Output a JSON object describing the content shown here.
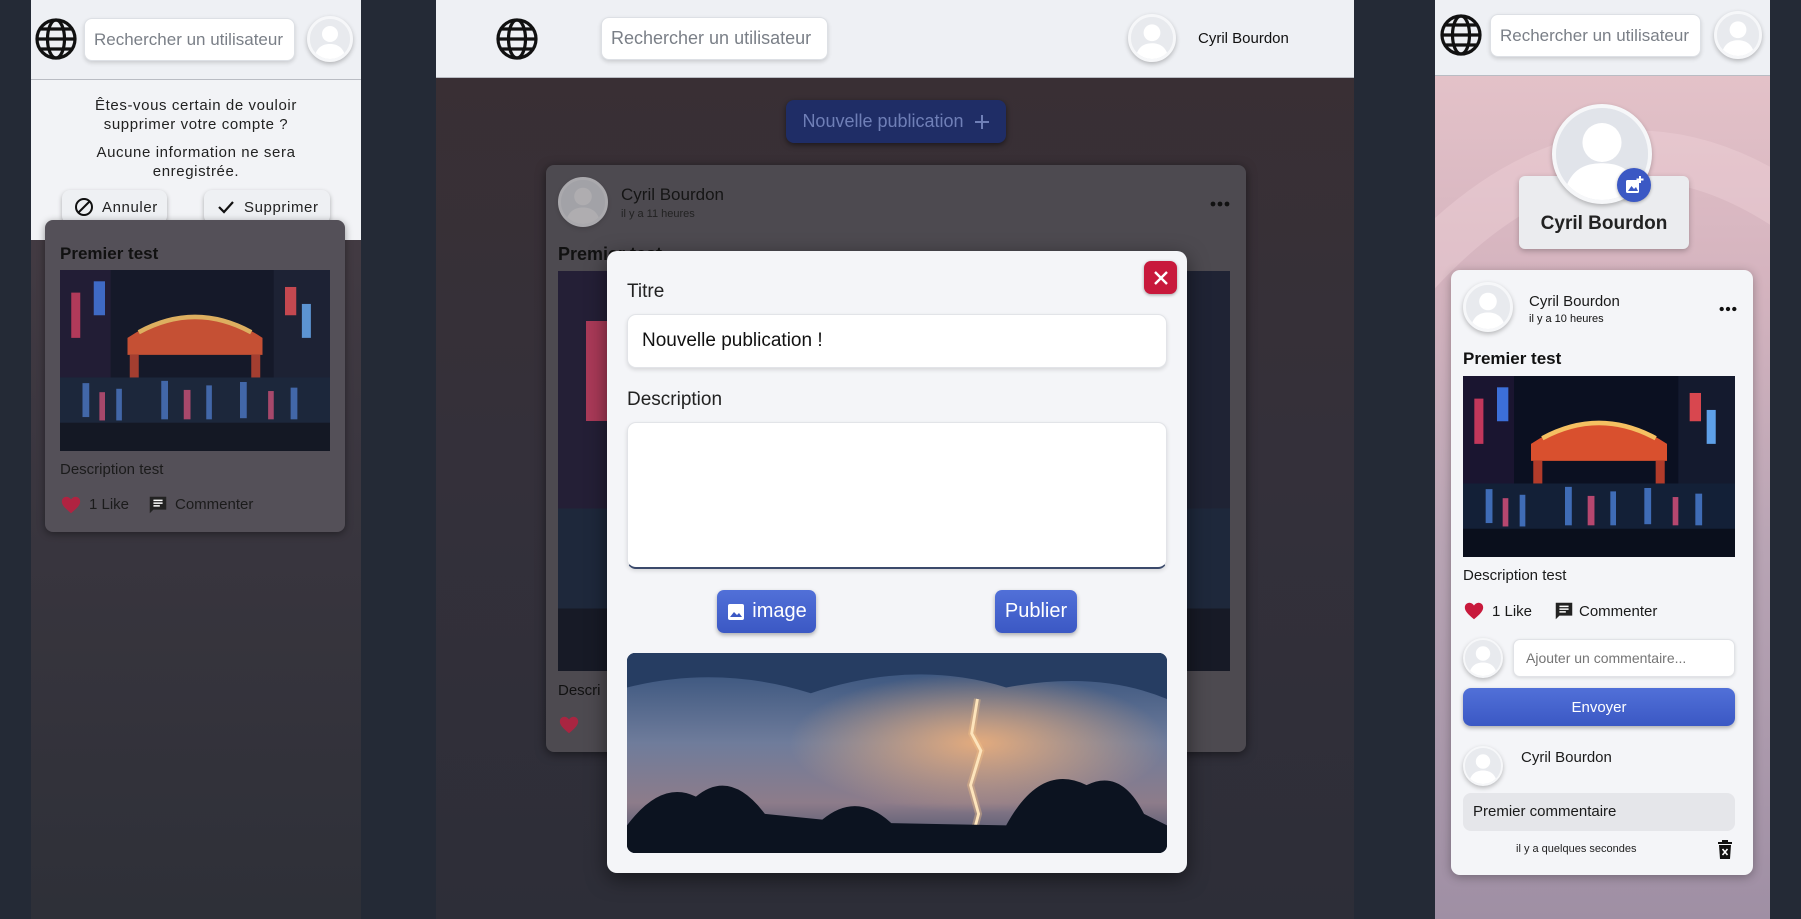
{
  "panel_left": {
    "search_placeholder": "Rechercher un utilisateur",
    "confirm": {
      "question": "Êtes-vous certain de vouloir supprimer votre compte ?",
      "info": "Aucune information ne sera enregistrée.",
      "cancel_label": "Annuler",
      "delete_label": "Supprimer"
    },
    "post": {
      "title": "Premier test",
      "description": "Description test",
      "likes": "1 Like",
      "comment_label": "Commenter"
    }
  },
  "panel_center": {
    "search_placeholder": "Rechercher un utilisateur",
    "user_name": "Cyril Bourdon",
    "new_post_label": "Nouvelle publication",
    "post": {
      "author": "Cyril Bourdon",
      "time": "il y a 11 heures",
      "title_partial": "Premier test",
      "description_partial": "Descri"
    },
    "modal": {
      "title_label": "Titre",
      "title_value": "Nouvelle publication !",
      "description_label": "Description",
      "description_value": "",
      "image_button": "image",
      "publish_button": "Publier"
    }
  },
  "panel_right": {
    "search_placeholder": "Rechercher un utilisateur",
    "profile_name": "Cyril Bourdon",
    "post": {
      "author": "Cyril Bourdon",
      "time": "il y a 10 heures",
      "title": "Premier test",
      "description": "Description test",
      "likes": "1 Like",
      "comment_label": "Commenter",
      "comment_placeholder": "Ajouter un commentaire...",
      "send_label": "Envoyer",
      "comment": {
        "author": "Cyril Bourdon",
        "text": "Premier commentaire",
        "time": "il y a quelques secondes"
      }
    }
  },
  "colors": {
    "accent_blue": "#3b58c4",
    "danger_red": "#c8193c",
    "heart_red": "#c8193c",
    "topbar_bg": "#eef0f4"
  },
  "icons": [
    "globe-icon",
    "user-avatar-icon",
    "cancel-circle-icon",
    "check-icon",
    "heart-icon",
    "comment-icon",
    "more-dots-icon",
    "plus-icon",
    "close-icon",
    "image-icon",
    "add-photo-icon",
    "trash-icon"
  ]
}
